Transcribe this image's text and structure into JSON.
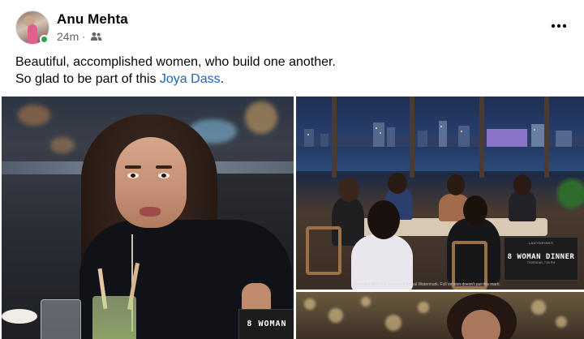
{
  "post": {
    "author": "Anu Mehta",
    "time": "24m",
    "separator": "·",
    "audience_icon": "group-icon",
    "more_icon": "more-horizontal-icon",
    "text_line1": "Beautiful, accomplished women, who build one another.",
    "text_line2_prefix": "So glad to be part of this ",
    "mention": "Joya Dass",
    "text_line2_suffix": "."
  },
  "photos": {
    "left_card": {
      "title": "8 WOMAN"
    },
    "right_card": {
      "kicker": "LADYDRINKS",
      "title": "8 WOMAN DINNER",
      "sub": "THURSDAY, 7:00 PM"
    },
    "watermark": "Protected with trial version of Visual Watermark. Full version doesn't put this mark."
  },
  "colors": {
    "link": "#1d65c1",
    "online": "#31a24c",
    "meta": "#65676b"
  }
}
